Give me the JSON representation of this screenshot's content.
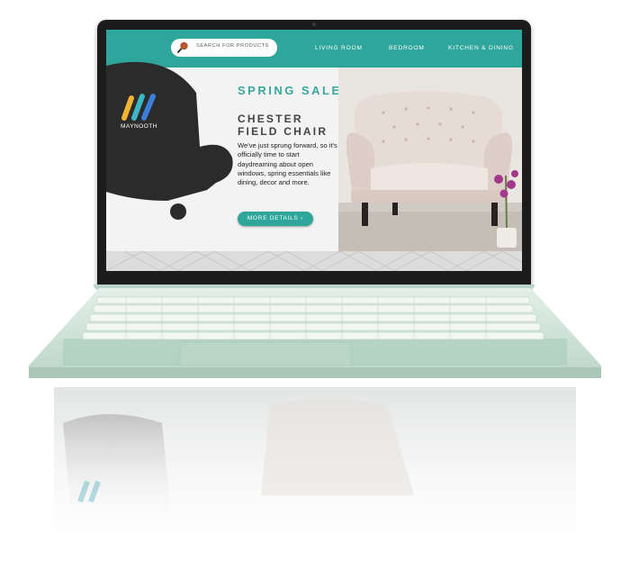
{
  "site": {
    "brand": "MAYNOOTH",
    "search": {
      "placeholder": "SEARCH FOR PRODUCTS",
      "icon": "search-icon"
    },
    "nav": [
      {
        "label": "LIVING ROOM"
      },
      {
        "label": "BEDROOM"
      },
      {
        "label": "KITCHEN & DINING"
      }
    ],
    "hero": {
      "headline": "SPRING SALE",
      "product": "CHESTER FIELD CHAIR",
      "description": "We've just sprung forward, so it's officially time to start daydreaming about open windows, spring essentials like dining, decor and more.",
      "cta": "MORE DETAILS ›"
    }
  },
  "colors": {
    "accent": "#2fa69b",
    "dark": "#2b2b2b",
    "laptop_body": "#cfe2d8"
  }
}
